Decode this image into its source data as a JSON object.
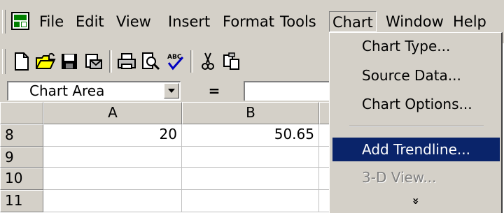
{
  "menubar": {
    "items": [
      {
        "label": "File"
      },
      {
        "label": "Edit"
      },
      {
        "label": "View"
      },
      {
        "label": "Insert"
      },
      {
        "label": "Format"
      },
      {
        "label": "Tools"
      },
      {
        "label": "Chart",
        "open": true
      },
      {
        "label": "Window"
      },
      {
        "label": "Help"
      }
    ]
  },
  "toolbar": {
    "buttons": [
      {
        "icon": "new-document-icon"
      },
      {
        "icon": "open-folder-icon"
      },
      {
        "icon": "save-disk-icon"
      },
      {
        "icon": "email-icon"
      },
      {
        "icon": "print-icon"
      },
      {
        "icon": "print-preview-icon"
      },
      {
        "icon": "spelling-check-icon"
      },
      {
        "icon": "cut-scissors-icon"
      },
      {
        "icon": "copy-icon"
      }
    ]
  },
  "formula_bar": {
    "name_box": "Chart Area",
    "equals": "="
  },
  "grid": {
    "columns": [
      "A",
      "B"
    ],
    "rows": [
      {
        "num": "8",
        "cells": [
          "20",
          "50.65"
        ]
      },
      {
        "num": "9",
        "cells": [
          "",
          ""
        ]
      },
      {
        "num": "10",
        "cells": [
          "",
          ""
        ]
      },
      {
        "num": "11",
        "cells": [
          "",
          ""
        ]
      }
    ]
  },
  "chart_menu": {
    "items": [
      {
        "label": "Chart Type...",
        "state": "enabled"
      },
      {
        "label": "Source Data...",
        "state": "enabled"
      },
      {
        "label": "Chart Options...",
        "state": "enabled"
      },
      {
        "label": "Add Trendline...",
        "state": "highlighted"
      },
      {
        "label": "3-D View...",
        "state": "disabled"
      }
    ],
    "expand_glyph": "»"
  },
  "colors": {
    "chrome": "#d4d0c8",
    "highlight": "#0a246a",
    "disabled_text": "#808080"
  }
}
